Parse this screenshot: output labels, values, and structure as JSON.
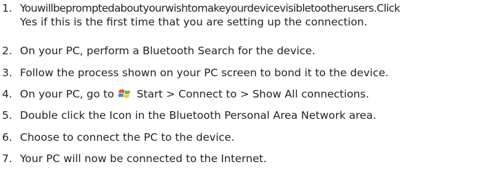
{
  "steps": [
    {
      "number": "1.",
      "lines": [
        "Youwillbepromptedaboutyourwishtomakeyourdevicevisibletootherusers.Click",
        "Yes if this is the first time that you are setting up the connection."
      ]
    },
    {
      "number": "2.",
      "text": "On your PC, perform a Bluetooth Search for the device."
    },
    {
      "number": "3.",
      "text": "Follow the process shown on your PC screen to bond it to the device."
    },
    {
      "number": "4.",
      "text_before_icon": "On your PC, go to",
      "icon": "windows-start-icon",
      "text_after_icon": "Start > Connect to > Show All connections."
    },
    {
      "number": "5.",
      "text": "Double click the Icon in the Bluetooth Personal Area Network area."
    },
    {
      "number": "6.",
      "text": "Choose to connect the PC to the device."
    },
    {
      "number": "7.",
      "text": "Your PC will now be connected to the Internet."
    }
  ],
  "colors": {
    "text": "#231f20",
    "windows_red": "#e8522b",
    "windows_green": "#69b444",
    "windows_blue": "#2f8fd8",
    "windows_yellow": "#ffc52f"
  }
}
